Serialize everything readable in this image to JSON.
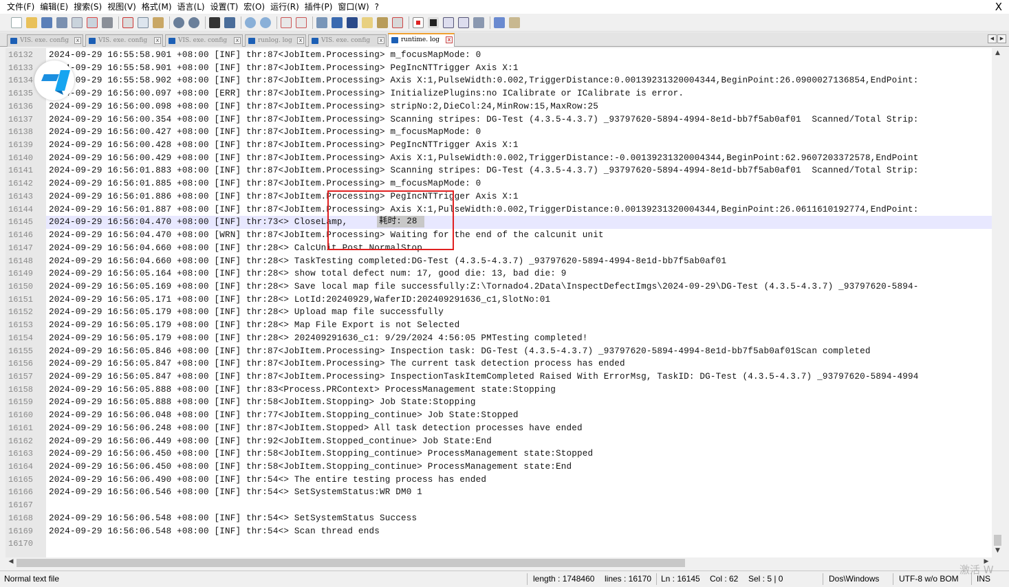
{
  "menu": [
    "文件(F)",
    "编辑(E)",
    "搜索(S)",
    "视图(V)",
    "格式(M)",
    "语言(L)",
    "设置(T)",
    "宏(O)",
    "运行(R)",
    "插件(P)",
    "窗口(W)",
    "?"
  ],
  "window_close": "X",
  "tabs": [
    {
      "label": "VIS. exe. config",
      "active": false
    },
    {
      "label": "VIS. exe. config",
      "active": false
    },
    {
      "label": "VIS. exe. config",
      "active": false
    },
    {
      "label": "runlog. log",
      "active": false
    },
    {
      "label": "VIS. exe. config",
      "active": false
    },
    {
      "label": "runtime. log",
      "active": true
    }
  ],
  "tab_nav": {
    "left": "◀",
    "right": "▶"
  },
  "tab_close": "x",
  "highlight_word": "耗时: 28",
  "lines": [
    {
      "n": "16132",
      "text": "2024-09-29 16:55:58.901 +08:00 [INF] thr:87<JobItem.Processing> m_focusMapMode: 0"
    },
    {
      "n": "16133",
      "text": "2024-09-29 16:55:58.901 +08:00 [INF] thr:87<JobItem.Processing> PegIncNTTrigger Axis X:1"
    },
    {
      "n": "16134",
      "text": "2024-09-29 16:55:58.902 +08:00 [INF] thr:87<JobItem.Processing> Axis X:1,PulseWidth:0.002,TriggerDistance:0.00139231320004344,BeginPoint:26.0900027136854,EndPoint:"
    },
    {
      "n": "16135",
      "text": "2024-09-29 16:56:00.097 +08:00 [ERR] thr:87<JobItem.Processing> InitializePlugins:no ICalibrate or ICalibrate is error."
    },
    {
      "n": "16136",
      "text": "2024-09-29 16:56:00.098 +08:00 [INF] thr:87<JobItem.Processing> stripNo:2,DieCol:24,MinRow:15,MaxRow:25"
    },
    {
      "n": "16137",
      "text": "2024-09-29 16:56:00.354 +08:00 [INF] thr:87<JobItem.Processing> Scanning stripes: DG-Test (4.3.5-4.3.7) _93797620-5894-4994-8e1d-bb7f5ab0af01  Scanned/Total Strip:"
    },
    {
      "n": "16138",
      "text": "2024-09-29 16:56:00.427 +08:00 [INF] thr:87<JobItem.Processing> m_focusMapMode: 0"
    },
    {
      "n": "16139",
      "text": "2024-09-29 16:56:00.428 +08:00 [INF] thr:87<JobItem.Processing> PegIncNTTrigger Axis X:1"
    },
    {
      "n": "16140",
      "text": "2024-09-29 16:56:00.429 +08:00 [INF] thr:87<JobItem.Processing> Axis X:1,PulseWidth:0.002,TriggerDistance:-0.00139231320004344,BeginPoint:62.9607203372578,EndPoint"
    },
    {
      "n": "16141",
      "text": "2024-09-29 16:56:01.883 +08:00 [INF] thr:87<JobItem.Processing> Scanning stripes: DG-Test (4.3.5-4.3.7) _93797620-5894-4994-8e1d-bb7f5ab0af01  Scanned/Total Strip:"
    },
    {
      "n": "16142",
      "text": "2024-09-29 16:56:01.885 +08:00 [INF] thr:87<JobItem.Processing> m_focusMapMode: 0"
    },
    {
      "n": "16143",
      "text": "2024-09-29 16:56:01.886 +08:00 [INF] thr:87<JobItem.Processing> PegIncNTTrigger Axis X:1"
    },
    {
      "n": "16144",
      "text": "2024-09-29 16:56:01.887 +08:00 [INF] thr:87<JobItem.Processing> Axis X:1,PulseWidth:0.002,TriggerDistance:0.00139231320004344,BeginPoint:26.0611610192774,EndPoint:"
    },
    {
      "n": "16145",
      "text": "2024-09-29 16:56:04.470 +08:00 [INF] thr:73<> CloseLamp, ",
      "current": true
    },
    {
      "n": "16146",
      "text": "2024-09-29 16:56:04.470 +08:00 [WRN] thr:87<JobItem.Processing> Waiting for the end of the calcunit unit"
    },
    {
      "n": "16147",
      "text": "2024-09-29 16:56:04.660 +08:00 [INF] thr:28<> CalcUnit Post NormalStop"
    },
    {
      "n": "16148",
      "text": "2024-09-29 16:56:04.660 +08:00 [INF] thr:28<> TaskTesting completed:DG-Test (4.3.5-4.3.7) _93797620-5894-4994-8e1d-bb7f5ab0af01"
    },
    {
      "n": "16149",
      "text": "2024-09-29 16:56:05.164 +08:00 [INF] thr:28<> show total defect num: 17, good die: 13, bad die: 9"
    },
    {
      "n": "16150",
      "text": "2024-09-29 16:56:05.169 +08:00 [INF] thr:28<> Save local map file successfully:Z:\\Tornado4.2Data\\InspectDefectImgs\\2024-09-29\\DG-Test (4.3.5-4.3.7) _93797620-5894-"
    },
    {
      "n": "16151",
      "text": "2024-09-29 16:56:05.171 +08:00 [INF] thr:28<> LotId:20240929,WaferID:202409291636_c1,SlotNo:01"
    },
    {
      "n": "16152",
      "text": "2024-09-29 16:56:05.179 +08:00 [INF] thr:28<> Upload map file successfully"
    },
    {
      "n": "16153",
      "text": "2024-09-29 16:56:05.179 +08:00 [INF] thr:28<> Map File Export is not Selected"
    },
    {
      "n": "16154",
      "text": "2024-09-29 16:56:05.179 +08:00 [INF] thr:28<> 202409291636_c1: 9/29/2024 4:56:05 PMTesting completed!"
    },
    {
      "n": "16155",
      "text": "2024-09-29 16:56:05.846 +08:00 [INF] thr:87<JobItem.Processing> Inspection task: DG-Test (4.3.5-4.3.7) _93797620-5894-4994-8e1d-bb7f5ab0af01Scan completed"
    },
    {
      "n": "16156",
      "text": "2024-09-29 16:56:05.847 +08:00 [INF] thr:87<JobItem.Processing> The current task detection process has ended"
    },
    {
      "n": "16157",
      "text": "2024-09-29 16:56:05.847 +08:00 [INF] thr:87<JobItem.Processing> InspectionTaskItemCompleted Raised With ErrorMsg, TaskID: DG-Test (4.3.5-4.3.7) _93797620-5894-4994"
    },
    {
      "n": "16158",
      "text": "2024-09-29 16:56:05.888 +08:00 [INF] thr:83<Process.PRContext> ProcessManagement state:Stopping"
    },
    {
      "n": "16159",
      "text": "2024-09-29 16:56:05.888 +08:00 [INF] thr:58<JobItem.Stopping> Job State:Stopping"
    },
    {
      "n": "16160",
      "text": "2024-09-29 16:56:06.048 +08:00 [INF] thr:77<JobItem.Stopping_continue> Job State:Stopped"
    },
    {
      "n": "16161",
      "text": "2024-09-29 16:56:06.248 +08:00 [INF] thr:87<JobItem.Stopped> All task detection processes have ended"
    },
    {
      "n": "16162",
      "text": "2024-09-29 16:56:06.449 +08:00 [INF] thr:92<JobItem.Stopped_continue> Job State:End"
    },
    {
      "n": "16163",
      "text": "2024-09-29 16:56:06.450 +08:00 [INF] thr:58<JobItem.Stopping_continue> ProcessManagement state:Stopped"
    },
    {
      "n": "16164",
      "text": "2024-09-29 16:56:06.450 +08:00 [INF] thr:58<JobItem.Stopping_continue> ProcessManagement state:End"
    },
    {
      "n": "16165",
      "text": "2024-09-29 16:56:06.490 +08:00 [INF] thr:54<> The entire testing process has ended"
    },
    {
      "n": "16166",
      "text": "2024-09-29 16:56:06.546 +08:00 [INF] thr:54<> SetSystemStatus:WR DM0 1"
    },
    {
      "n": "16167",
      "text": ""
    },
    {
      "n": "16168",
      "text": "2024-09-29 16:56:06.548 +08:00 [INF] thr:54<> SetSystemStatus Success"
    },
    {
      "n": "16169",
      "text": "2024-09-29 16:56:06.548 +08:00 [INF] thr:54<> Scan thread ends"
    },
    {
      "n": "16170",
      "text": ""
    }
  ],
  "scroll_arrows": {
    "up": "▲",
    "down": "▼",
    "left": "◀",
    "right": "▶"
  },
  "status": {
    "file_type": "Normal text file",
    "length": "length : 1748460",
    "lines": "lines : 16170",
    "ln": "Ln : 16145",
    "col": "Col : 62",
    "sel": "Sel : 5 | 0",
    "eol": "Dos\\Windows",
    "encoding": "UTF-8 w/o BOM",
    "mode": "INS"
  },
  "watermark": "激活 W",
  "toolbar_icons": [
    "new-file-icon",
    "open-file-icon",
    "save-icon",
    "save-all-icon",
    "close-icon",
    "close-all-icon",
    "print-icon",
    "cut-icon",
    "copy-icon",
    "paste-icon",
    "undo-icon",
    "redo-icon",
    "find-icon",
    "replace-icon",
    "zoom-in-icon",
    "zoom-out-icon",
    "sync-v-icon",
    "sync-h-icon",
    "word-wrap-icon",
    "show-all-chars-icon",
    "indent-guide-icon",
    "udl-icon",
    "doc-map-icon",
    "function-list-icon",
    "record-macro-icon",
    "stop-macro-icon",
    "play-macro-icon",
    "run-macro-multiple-icon",
    "save-macro-icon",
    "spell-check-icon",
    "plugin-icon"
  ],
  "colors": {
    "accent_tab": "#f0a030",
    "gutter": "#e8e8e8",
    "current_line": "#e8e8ff",
    "annotation_box": "#e02020"
  }
}
